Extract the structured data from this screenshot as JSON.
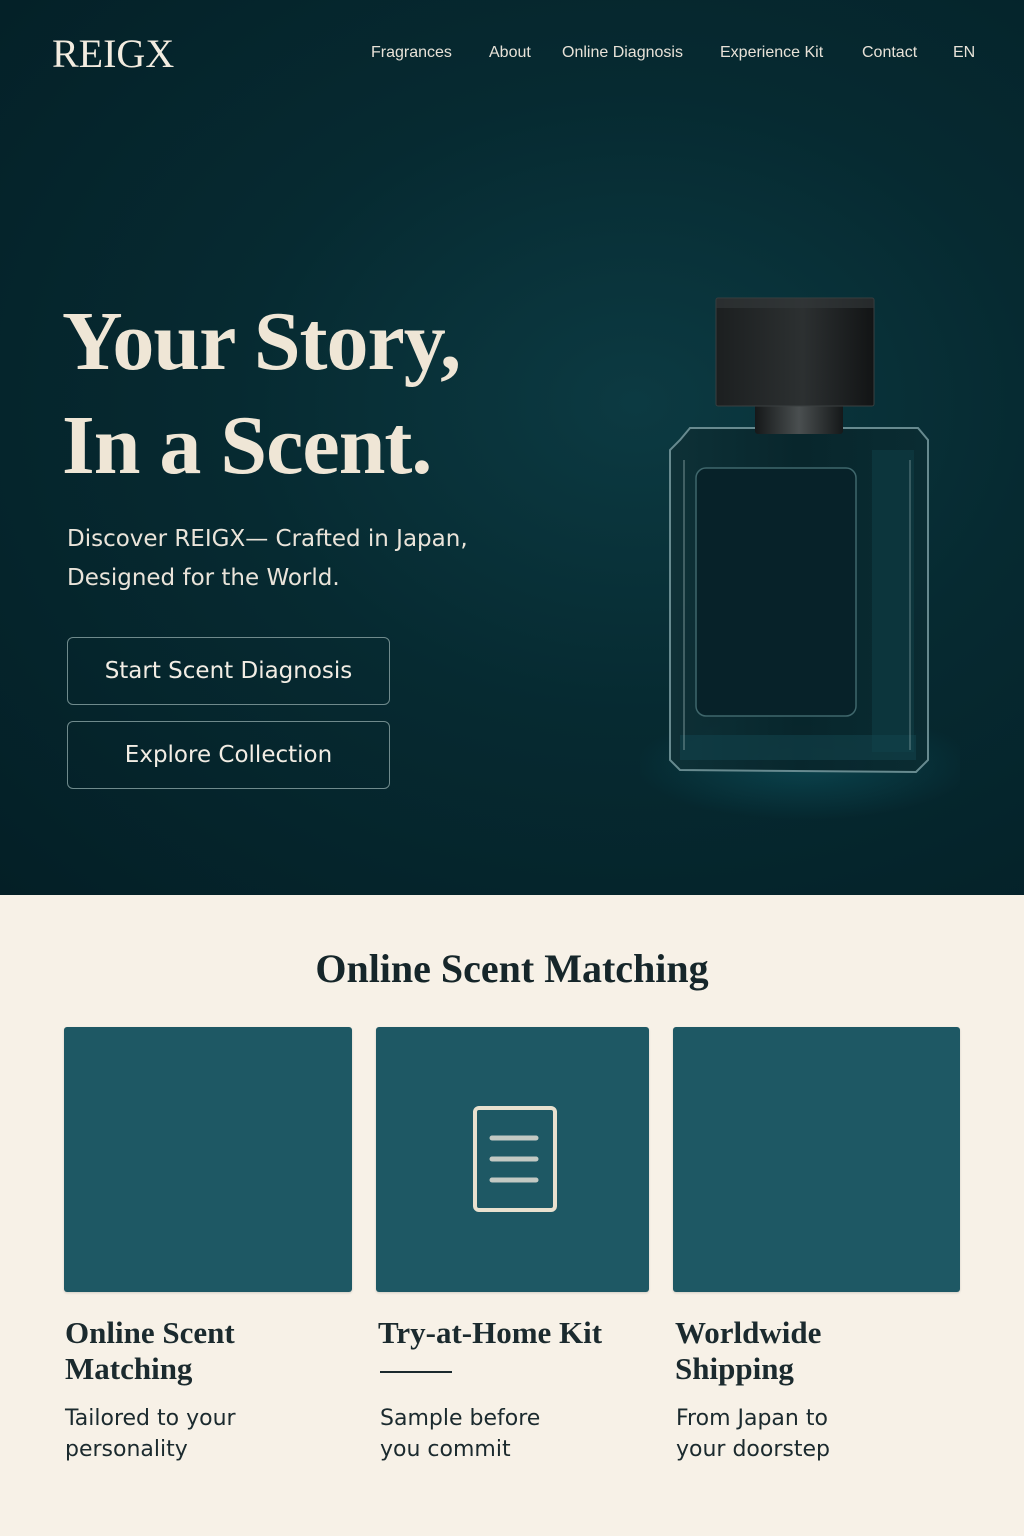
{
  "brand": {
    "logo": "REIGX"
  },
  "nav": {
    "items": [
      {
        "label": "Fragrances"
      },
      {
        "label": "About"
      },
      {
        "label": "Online Diagnosis"
      },
      {
        "label": "Experience Kit"
      },
      {
        "label": "Contact"
      },
      {
        "label": "EN"
      }
    ]
  },
  "hero": {
    "title_line1": "Your Story,",
    "title_line2": "In a Scent.",
    "subtitle_line1": "Discover REIGX— Crafted in Japan,",
    "subtitle_line2": "Designed for the World.",
    "primary_button": "Start Scent Diagnosis",
    "secondary_button": "Explore Collection",
    "image": "perfume-bottle"
  },
  "features": {
    "heading": "Online Scent Matching",
    "cards": [
      {
        "title_line1": "Online Scent",
        "title_line2": "Matching",
        "desc_line1": "Tailored to your",
        "desc_line2": "personality",
        "icon": ""
      },
      {
        "title_line1": "Try-at-Home Kit",
        "title_line2": "",
        "desc_line1": "Sample before",
        "desc_line2": "you commit",
        "icon": "document-icon"
      },
      {
        "title_line1": "Worldwide",
        "title_line2": "Shipping",
        "desc_line1": "From Japan to",
        "desc_line2": "your doorstep",
        "icon": ""
      }
    ]
  },
  "colors": {
    "hero_bg": "#062a31",
    "accent_teal": "#1e5864",
    "cream": "#f7f1e7",
    "text_light": "#efe6d6",
    "text_dark": "#1b2a2e"
  }
}
